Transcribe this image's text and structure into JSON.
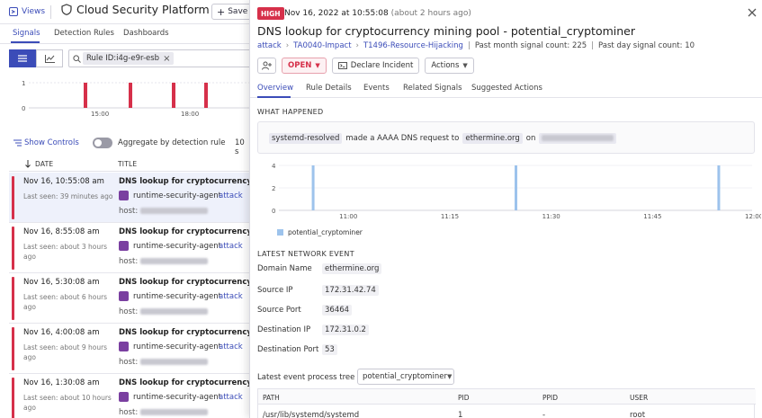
{
  "left": {
    "views_label": "Views",
    "app_title": "Cloud Security Platform",
    "save_label": "Save",
    "nav_tabs": [
      "Signals",
      "Detection Rules",
      "Dashboards"
    ],
    "search_chip": "Rule ID:i4g-e9r-esb",
    "mini_chart": {
      "y_ticks": [
        "1",
        "0"
      ],
      "x_ticks": [
        "15:00",
        "18:00"
      ]
    },
    "show_controls": "Show Controls",
    "aggregate_label": "Aggregate by detection rule",
    "count_label": "10 s",
    "columns": {
      "date": "DATE",
      "title": "TITLE"
    },
    "rows": [
      {
        "date": "Nov 16, 10:55:08 am",
        "seen": "Last seen: 39 minutes ago",
        "title": "DNS lookup for cryptocurrency minin",
        "agent": "runtime-security-agent",
        "attack": "attack",
        "host": "host:"
      },
      {
        "date": "Nov 16, 8:55:08 am",
        "seen": "Last seen: about 3 hours ago",
        "title": "DNS lookup for cryptocurrency minin",
        "agent": "runtime-security-agent",
        "attack": "attack",
        "host": "host:"
      },
      {
        "date": "Nov 16, 5:30:08 am",
        "seen": "Last seen: about 6 hours ago",
        "title": "DNS lookup for cryptocurrency minin",
        "agent": "runtime-security-agent",
        "attack": "attack",
        "host": "host:"
      },
      {
        "date": "Nov 16, 4:00:08 am",
        "seen": "Last seen: about 9 hours ago",
        "title": "DNS lookup for cryptocurrency minin",
        "agent": "runtime-security-agent",
        "attack": "attack",
        "host": "host:"
      },
      {
        "date": "Nov 16, 1:30:08 am",
        "seen": "Last seen: about 10 hours ago",
        "title": "DNS lookup for cryptocurrency minin",
        "agent": "runtime-security-agent",
        "attack": "attack",
        "host": "host:"
      }
    ]
  },
  "right": {
    "severity": "HIGH",
    "timestamp": "Nov 16, 2022 at 10:55:08",
    "relative_time": "(about 2 hours ago)",
    "title": "DNS lookup for cryptocurrency mining pool - potential_cryptominer",
    "breadcrumbs": [
      "attack",
      "TA0040-Impact",
      "T1496-Resource-Hijacking"
    ],
    "past_month": "Past month signal count: 225",
    "past_day": "Past day signal count: 10",
    "status": "OPEN",
    "declare_incident": "Declare Incident",
    "actions": "Actions",
    "tabs": [
      "Overview",
      "Rule Details",
      "Events",
      "Related Signals",
      "Suggested Actions"
    ],
    "what_happened_title": "WHAT HAPPENED",
    "what": {
      "process": "systemd-resolved",
      "text": "made a AAAA DNS request to",
      "domain": "ethermine.org",
      "on": "on"
    },
    "chart_data": {
      "type": "bar",
      "x_ticks": [
        "11:00",
        "11:15",
        "11:30",
        "11:45",
        "12:00"
      ],
      "y_ticks": [
        "4",
        "2",
        "0"
      ],
      "ylim": [
        0,
        4
      ],
      "series": [
        {
          "name": "potential_cryptominer",
          "color": "#9dc3ec",
          "x": [
            "10:55",
            "11:25",
            "11:55"
          ],
          "values": [
            4,
            4,
            4
          ]
        }
      ]
    },
    "network_title": "LATEST NETWORK EVENT",
    "network": [
      {
        "label": "Domain Name",
        "value": "ethermine.org"
      },
      {
        "label": "Source IP",
        "value": "172.31.42.74"
      },
      {
        "label": "Source Port",
        "value": "36464"
      },
      {
        "label": "Destination IP",
        "value": "172.31.0.2"
      },
      {
        "label": "Destination Port",
        "value": "53"
      }
    ],
    "ptree_label": "Latest event process tree for",
    "ptree_value": "potential_cryptominer",
    "ptable": {
      "headers": [
        "PATH",
        "PID",
        "PPID",
        "USER"
      ],
      "row": [
        "/usr/lib/systemd/systemd",
        "1",
        "-",
        "root"
      ]
    }
  }
}
